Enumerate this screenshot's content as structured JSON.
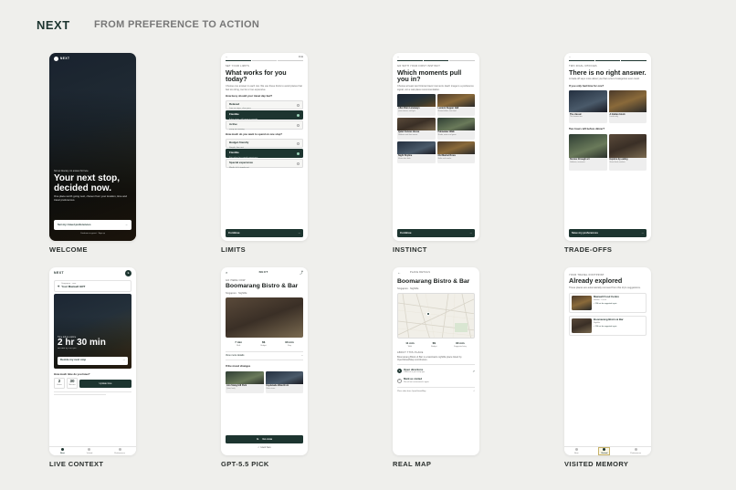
{
  "header": {
    "brand": "NEXT",
    "tagline": "FROM PREFERENCE TO ACTION"
  },
  "captions": [
    "WELCOME",
    "LIMITS",
    "INSTINCT",
    "TRADE-OFFS",
    "LIVE CONTEXT",
    "GPT-5.5 PICK",
    "REAL MAP",
    "VISITED MEMORY"
  ],
  "welcome": {
    "logo": "NEXT",
    "kicker": "Not an itinerary. An answer for here.",
    "title": "Your next stop, decided now.",
    "sub": "One place worth going next, chosen from your location, time and travel preferences.",
    "cta": "Set my travel preferences",
    "foot": "Continue as guest · Sign up"
  },
  "limits": {
    "status_time": "9:41",
    "eyebrow": "Set your limits",
    "title": "What works for you today?",
    "sub": "Choose one answer in each row. We use these limits to avoid places that feel too tiring, too far or too expensive.",
    "q1": "How busy should your travel day feel?",
    "q1_opts": [
      {
        "label": "Relaxed",
        "sub": "Low on steps, slow pace"
      },
      {
        "label": "Flexible",
        "sub": "A few stops, still room to wander"
      },
      {
        "label": "Active",
        "sub": "Keep me moving"
      }
    ],
    "q2": "How much do you want to spend on one stop?",
    "q2_opts": [
      {
        "label": "Budget-friendly",
        "sub": "Simple, low cost"
      },
      {
        "label": "Flexible",
        "sub": "Fair value for a good experience"
      },
      {
        "label": "Special experience",
        "sub": "Worth it if it stands out"
      }
    ],
    "cta": "Continue"
  },
  "instinct": {
    "eyebrow": "Go with your first instinct",
    "title": "Which moments pull you in?",
    "sub": "Choose at least two fictional travel moments. Each image is a preference signal, not a real place recommendation.",
    "cards": [
      {
        "title": "After-Rain Laneways",
        "sub": "Quiet streets, soft light"
      },
      {
        "title": "Lantern Supper Hall",
        "sub": "Shared tables, late food"
      },
      {
        "title": "Quiet Canvas House",
        "sub": "Galleries and slow rooms"
      },
      {
        "title": "Palmwater Walk",
        "sub": "Shade, water and green"
      },
      {
        "title": "Night Skyline",
        "sub": "Views after dark"
      },
      {
        "title": "Old Market Rows",
        "sub": "Stalls and snacks"
      }
    ],
    "cta": "Continue"
  },
  "tradeoffs": {
    "eyebrow": "Two final choices",
    "title": "There is no right answer.",
    "sub": "A trade-off says more about you than a list of categories ever could.",
    "q1": "If you only had time for one?",
    "q1_cards": [
      {
        "title": "The classic",
        "sub": "The famous one"
      },
      {
        "title": "A hidden block",
        "sub": "Locals only"
      }
    ],
    "q2": "Two hours left before dinner?",
    "q2_cards": [
      {
        "title": "Stories through art",
        "sub": "Galleries, museums"
      },
      {
        "title": "Explore by eating",
        "sub": "Street food, markets"
      }
    ],
    "cta": "Save my preferences"
  },
  "live": {
    "logo": "NEXT",
    "loc_label": "Singapore · now",
    "place": "Your Maxwell GRT",
    "time_label": "Time left to explore",
    "time": "2 hr 30 min",
    "sub": "Be back by 5:45 pm",
    "cta": "Decide my next stop",
    "question": "How much time do you have?",
    "hours": "2",
    "hours_label": "Hours",
    "mins": "30",
    "mins_label": "Minutes",
    "update": "Update time",
    "nav": [
      "Next",
      "Visited",
      "Preferences"
    ]
  },
  "pick": {
    "logo": "NEXT",
    "eyebrow": "Go here now",
    "title": "Boomarang Bistro & Bar",
    "sub": "Singapore · Nightlife",
    "stats": [
      {
        "v": "7 min",
        "l": "Walk"
      },
      {
        "v": "$$",
        "l": "Budget"
      },
      {
        "v": "90 min",
        "l": "Stay"
      }
    ],
    "why": "View more details",
    "alt_label": "If the mood changes",
    "alts": [
      {
        "title": "Ann Siang Hill Park",
        "sub": "Quiet, leafy"
      },
      {
        "title": "Esplanade Waterfront",
        "sub": "River views"
      }
    ],
    "cta": "Go now",
    "foot": "I went here"
  },
  "map": {
    "eyebrow": "Place details",
    "title": "Boomarang Bistro & Bar",
    "sub": "Singapore · Nightlife",
    "stats": [
      {
        "v": "11 min",
        "l": "Walk"
      },
      {
        "v": "$$",
        "l": "Budget"
      },
      {
        "v": "90 min",
        "l": "Suggested stay"
      }
    ],
    "about": "About this place",
    "desc": "Boomarang Bistro & Bar is a laid-back nightlife place listed by OpenStreetMap contributors.",
    "actions": [
      {
        "title": "Open directions",
        "sub": "Continue in your map app"
      },
      {
        "title": "Mark as visited",
        "sub": "We will not recommend it again"
      }
    ],
    "source": "Place data from OpenStreetMap"
  },
  "visited": {
    "eyebrow": "Your travel footprint",
    "title": "Already explored",
    "sub": "These places are automatically removed from this trip's suggestions.",
    "items": [
      {
        "title": "Maxwell Food Centre",
        "sub": "Hawker · Lunch",
        "tag": "Will not be suggested again"
      },
      {
        "title": "Boomarang Bistro & Bar",
        "sub": "Nightlife",
        "tag": "Will not be suggested again"
      }
    ],
    "nav": [
      "Next",
      "Visited",
      "Preferences"
    ]
  }
}
